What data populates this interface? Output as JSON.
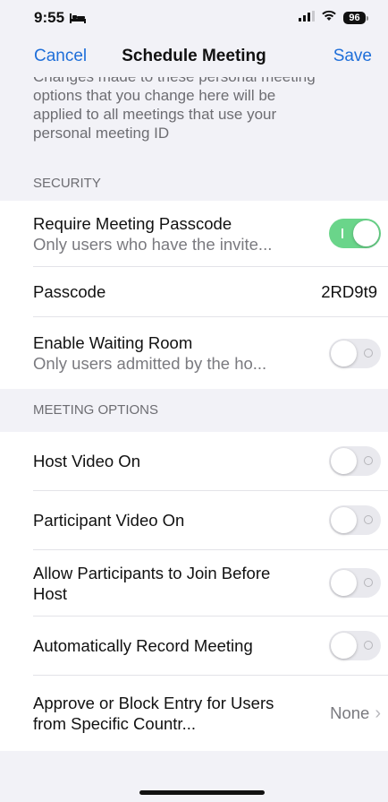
{
  "status_bar": {
    "time": "9:55",
    "battery": "96",
    "icons": [
      "bed-icon",
      "signal-icon",
      "wifi-icon",
      "battery-icon"
    ]
  },
  "nav": {
    "cancel": "Cancel",
    "title": "Schedule Meeting",
    "save": "Save"
  },
  "note": {
    "text": "... options that you change here will be applied to all meetings that use your personal meeting ID",
    "lines": [
      "Changes made to these personal meeting",
      "options that you change here will be",
      "applied to all meetings that use your",
      "personal meeting ID"
    ]
  },
  "security": {
    "header": "SECURITY",
    "require_passcode": {
      "title": "Require Meeting Passcode",
      "subtitle": "Only users who have the invite...",
      "enabled": true
    },
    "passcode": {
      "label": "Passcode",
      "value": "2RD9t9"
    },
    "waiting_room": {
      "title": "Enable Waiting Room",
      "subtitle": "Only users admitted by the ho...",
      "enabled": false
    }
  },
  "meeting_options": {
    "header": "MEETING OPTIONS",
    "items": [
      {
        "title": "Host Video On",
        "enabled": false
      },
      {
        "title": "Participant Video On",
        "enabled": false
      },
      {
        "title": "Allow Participants to Join Before Host",
        "enabled": false
      },
      {
        "title": "Automatically Record Meeting",
        "enabled": false
      }
    ],
    "country": {
      "title": "Approve or Block Entry for Users from Specific Countr...",
      "value": "None"
    }
  },
  "colors": {
    "accent": "#1f6fd9",
    "toggle_on": "#6ad58a",
    "background": "#f2f2f7"
  }
}
